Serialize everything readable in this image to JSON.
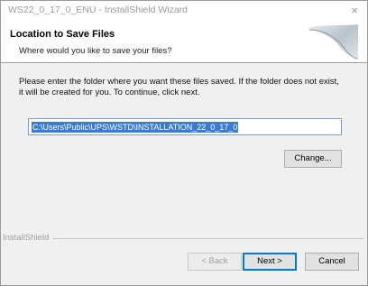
{
  "window": {
    "title": "WS22_0_17_0_ENU - InstallShield Wizard",
    "close_glyph": "×"
  },
  "header": {
    "title": "Location to Save Files",
    "subtitle": "Where would you like to save your files?"
  },
  "main": {
    "instruction": "Please enter the folder where you want these files saved. If the folder does not exist, it will be created for you. To continue, click next.",
    "path_value": "C:\\Users\\Public\\UPS\\WSTD\\INSTALLATION_22_0_17_0",
    "change_label": "Change..."
  },
  "footer": {
    "brand_label": "InstallShield",
    "back_label": "< Back",
    "next_label": "Next >",
    "cancel_label": "Cancel"
  },
  "colors": {
    "selection": "#3a7bd5",
    "default_button_border": "#0078d7"
  }
}
